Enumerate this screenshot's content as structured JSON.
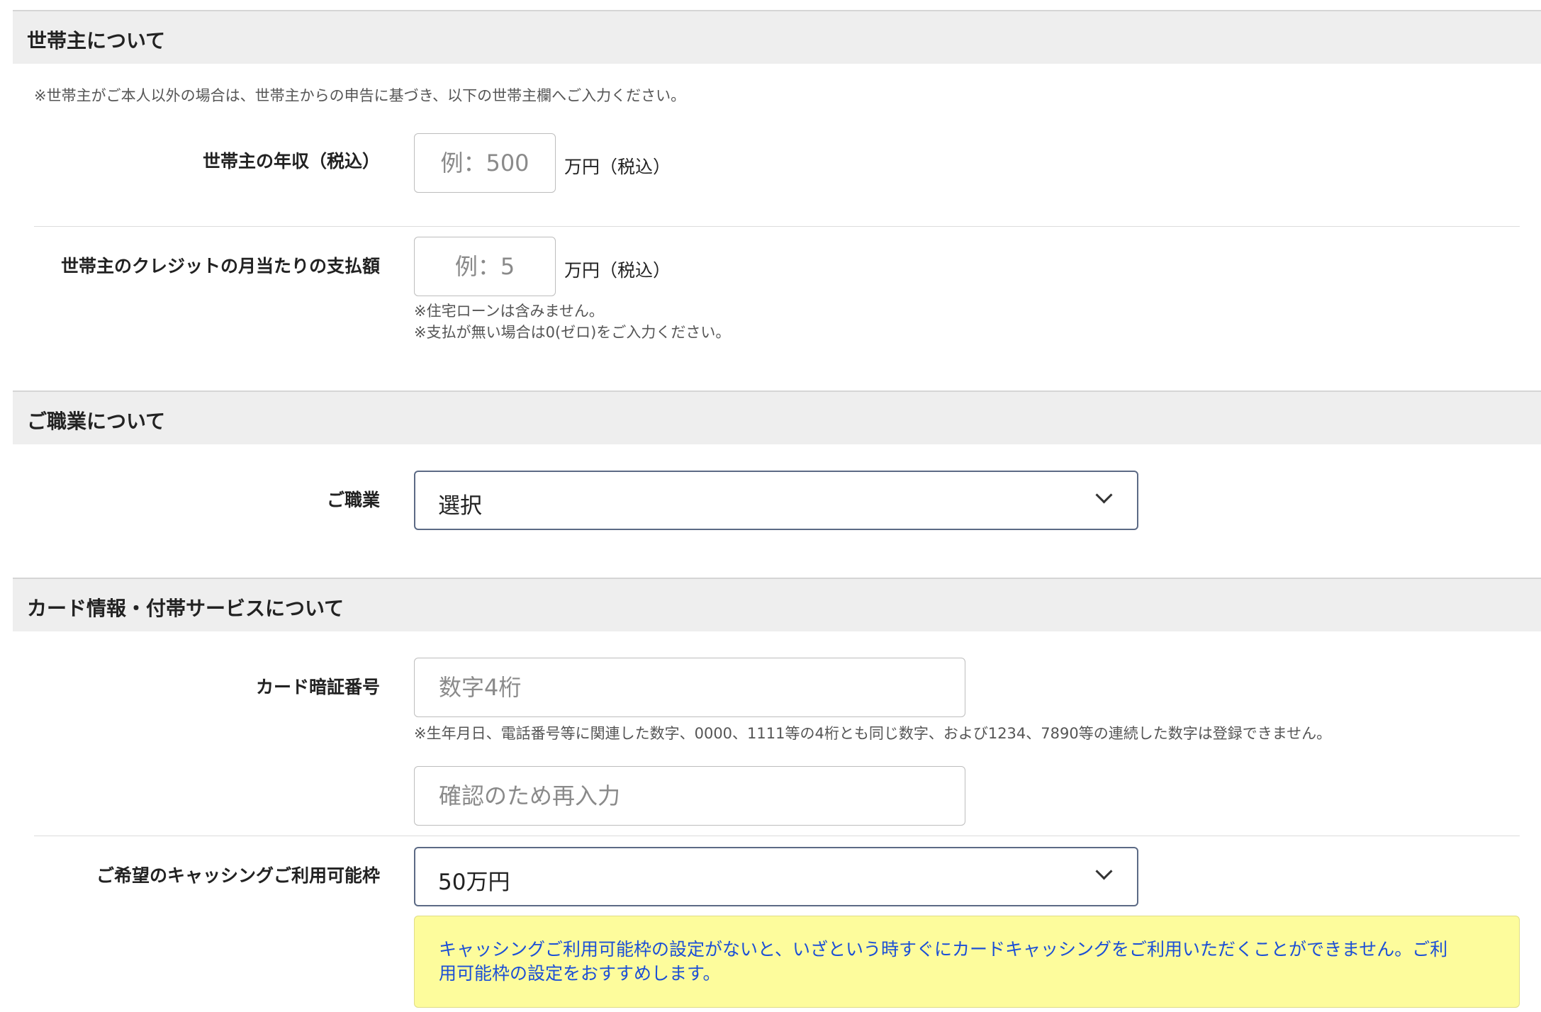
{
  "household_section": {
    "title": "世帯主について",
    "note": "※世帯主がご本人以外の場合は、世帯主からの申告に基づき、以下の世帯主欄へご入力ください。",
    "income": {
      "label": "世帯主の年収（税込）",
      "placeholder": "例：500",
      "value": "",
      "unit": "万円（税込）"
    },
    "credit_payment": {
      "label": "世帯主のクレジットの月当たりの支払額",
      "placeholder": "例：5",
      "value": "",
      "unit": "万円（税込）",
      "notes": [
        "※住宅ローンは含みません。",
        "※支払が無い場合は0(ゼロ)をご入力ください。"
      ]
    }
  },
  "occupation_section": {
    "title": "ご職業について",
    "occupation": {
      "label": "ご職業",
      "selected": "選択"
    }
  },
  "card_section": {
    "title": "カード情報・付帯サービスについて",
    "pin": {
      "label": "カード暗証番号",
      "placeholder": "数字4桁",
      "value": "",
      "note": "※生年月日、電話番号等に関連した数字、0000、1111等の4桁とも同じ数字、および1234、7890等の連続した数字は登録できません。",
      "confirm_placeholder": "確認のため再入力",
      "confirm_value": ""
    },
    "cashing_limit": {
      "label": "ご希望のキャッシングご利用可能枠",
      "selected": "50万円"
    },
    "notice_lines": [
      "キャッシングご利用可能枠の設定がないと、いざという時すぐにカードキャッシングをご利用いただくことができません。ご利",
      "用可能枠の設定をおすすめします。"
    ]
  },
  "colors": {
    "section_bg": "#eeeeee",
    "notice_bg": "#fdfc9c",
    "notice_text": "#1b4fd6",
    "select_border": "#5c6a85"
  }
}
